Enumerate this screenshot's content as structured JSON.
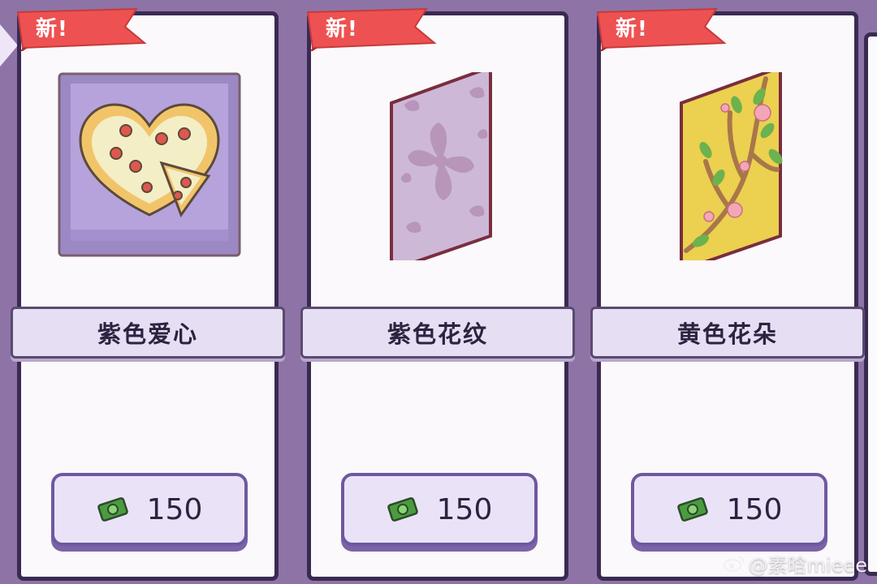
{
  "colors": {
    "background": "#8e74a6",
    "card": "#fbf9fb",
    "ribbon": "#ee5151",
    "name_bar": "#e6dff3",
    "price_button": "#eae3f7"
  },
  "shop": {
    "items": [
      {
        "badge": "新!",
        "name": "紫色爱心",
        "price": "150",
        "image_icon": "heart-pizza-wallpaper-icon",
        "currency_icon": "cash-icon"
      },
      {
        "badge": "新!",
        "name": "紫色花纹",
        "price": "150",
        "image_icon": "purple-damask-wallpaper-icon",
        "currency_icon": "cash-icon"
      },
      {
        "badge": "新!",
        "name": "黄色花朵",
        "price": "150",
        "image_icon": "yellow-blossom-wallpaper-icon",
        "currency_icon": "cash-icon"
      }
    ]
  },
  "watermark": {
    "text": "@素晗mieee",
    "icon": "weibo-icon"
  }
}
